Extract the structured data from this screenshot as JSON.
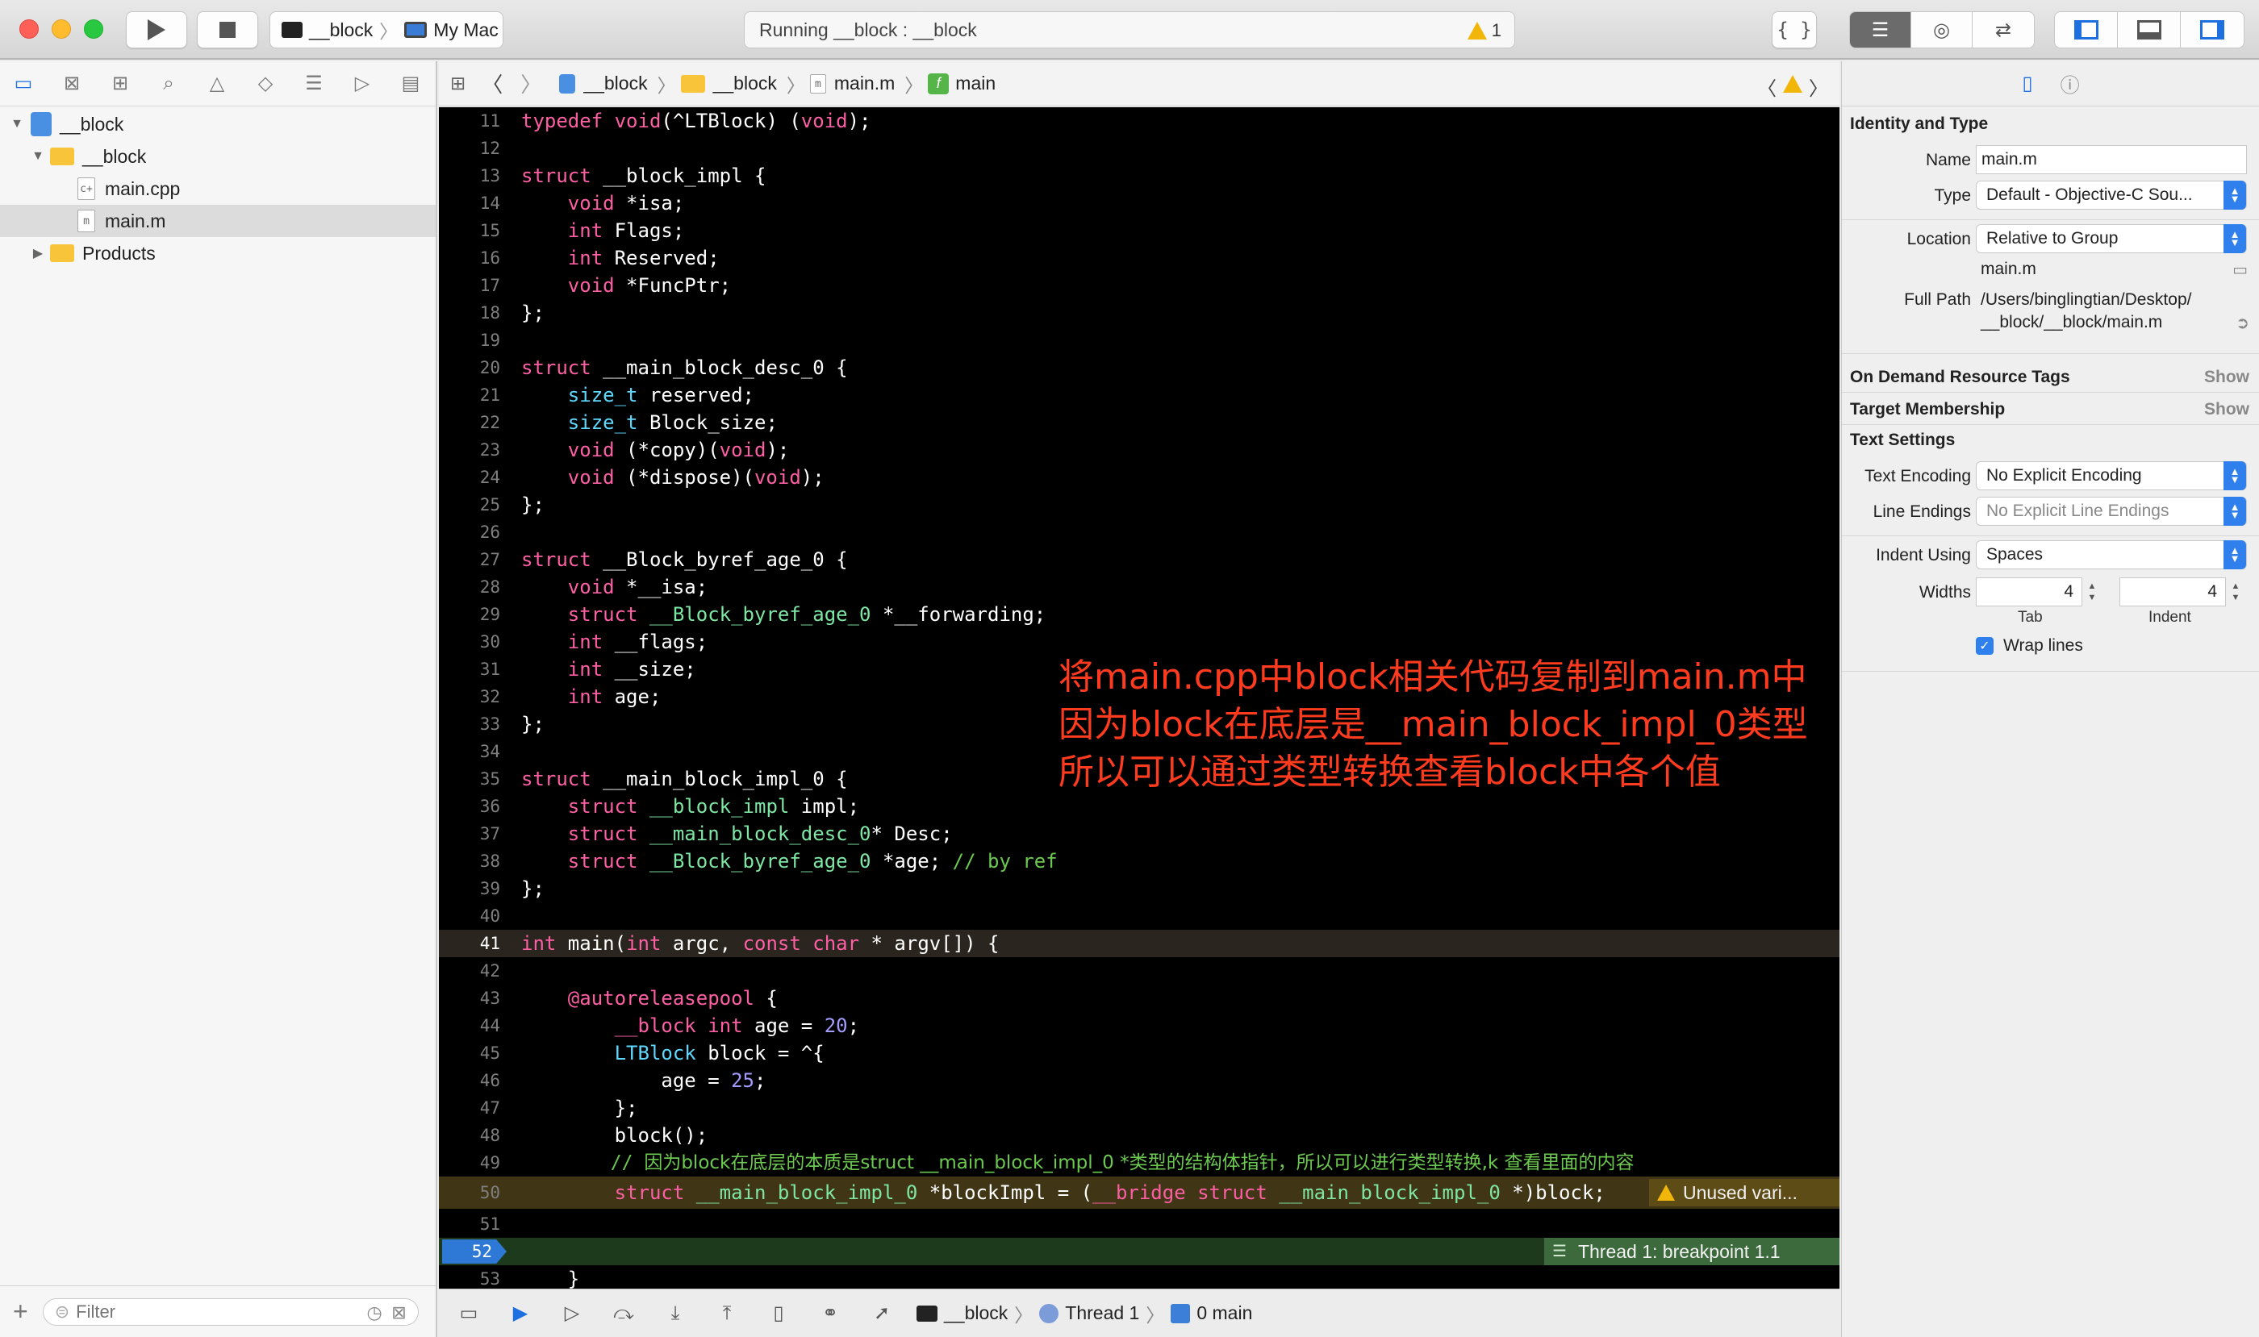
{
  "toolbar": {
    "scheme_target": "__block",
    "scheme_device": "My Mac",
    "activity_status": "Running __block : __block",
    "warning_count": "1",
    "braces_label": "{ }"
  },
  "navigator": {
    "items": [
      {
        "name": "__block",
        "kind": "project"
      },
      {
        "name": "__block",
        "kind": "folder"
      },
      {
        "name": "main.cpp",
        "kind": "file-cpp"
      },
      {
        "name": "main.m",
        "kind": "file-m"
      },
      {
        "name": "Products",
        "kind": "folder"
      }
    ],
    "filter_placeholder": "Filter"
  },
  "jumpbar": {
    "crumbs": [
      "__block",
      "__block",
      "main.m",
      "main"
    ]
  },
  "editor": {
    "current_line": "41",
    "breakpoint_line": "52",
    "warning_text": "Unused vari...",
    "breakpoint_text": "Thread 1: breakpoint 1.1",
    "annotation": [
      "将main.cpp中block相关代码复制到main.m中",
      "因为block在底层是__main_block_impl_0类型",
      "所以可以通过类型转换查看block中各个值"
    ]
  },
  "debugbar": {
    "target": "__block",
    "thread": "Thread 1",
    "frame": "0 main"
  },
  "inspector": {
    "identity_title": "Identity and Type",
    "name_label": "Name",
    "name_value": "main.m",
    "type_label": "Type",
    "type_value": "Default - Objective-C Sou...",
    "location_label": "Location",
    "location_value": "Relative to Group",
    "location_file": "main.m",
    "fullpath_label": "Full Path",
    "fullpath_line1": "/Users/binglingtian/Desktop/",
    "fullpath_line2": "__block/__block/main.m",
    "ondemand_title": "On Demand Resource Tags",
    "target_title": "Target Membership",
    "show_label": "Show",
    "text_settings_title": "Text Settings",
    "encoding_label": "Text Encoding",
    "encoding_value": "No Explicit Encoding",
    "line_endings_label": "Line Endings",
    "line_endings_value": "No Explicit Line Endings",
    "indent_using_label": "Indent Using",
    "indent_using_value": "Spaces",
    "widths_label": "Widths",
    "tab_width": "4",
    "indent_width": "4",
    "tab_label": "Tab",
    "indent_label": "Indent",
    "wrap_label": "Wrap lines"
  },
  "colors": {
    "keyword": "#fc5fa3",
    "type": "#5dd8ff",
    "project_type": "#7ee7a4",
    "number": "#a39cff",
    "string": "#fc6a5d",
    "comment": "#6cc94f",
    "annotation": "#ff3b1f",
    "accent": "#2f80ed"
  }
}
